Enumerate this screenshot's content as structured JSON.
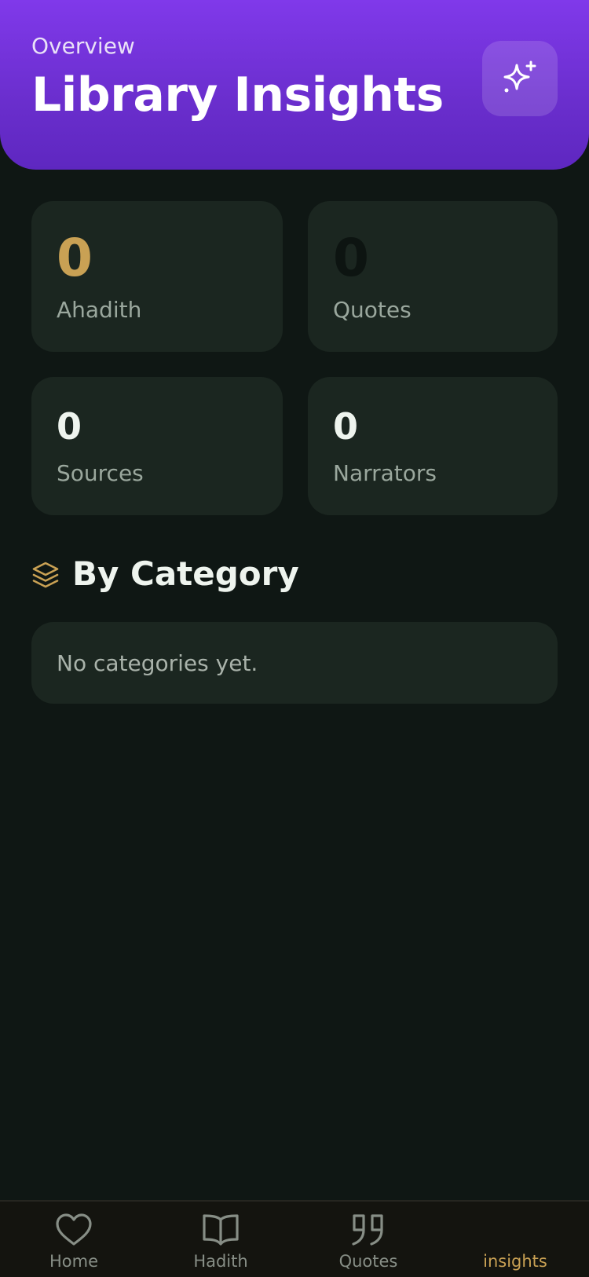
{
  "header": {
    "eyebrow": "Overview",
    "title": "Library Insights",
    "action_icon": "sparkles-icon"
  },
  "stats": [
    {
      "value": "0",
      "label": "Ahadith",
      "color": "#c9a154"
    },
    {
      "value": "0",
      "label": "Quotes",
      "color": "#0d1411"
    },
    {
      "value": "0",
      "label": "Sources",
      "color": "#eef4ee"
    },
    {
      "value": "0",
      "label": "Narrators",
      "color": "#eef4ee"
    }
  ],
  "category_section": {
    "icon": "layers-icon",
    "title": "By Category",
    "empty_message": "No categories yet."
  },
  "tabs": [
    {
      "label": "Home",
      "icon": "heart-icon",
      "active": false
    },
    {
      "label": "Hadith",
      "icon": "book-open-icon",
      "active": false
    },
    {
      "label": "Quotes",
      "icon": "quote-icon",
      "active": false
    },
    {
      "label": "insights",
      "icon": "",
      "active": true
    }
  ],
  "colors": {
    "accent_purple": "#7b35e6",
    "accent_gold": "#c9a154",
    "background": "#0f1714",
    "card": "#1b2620"
  }
}
